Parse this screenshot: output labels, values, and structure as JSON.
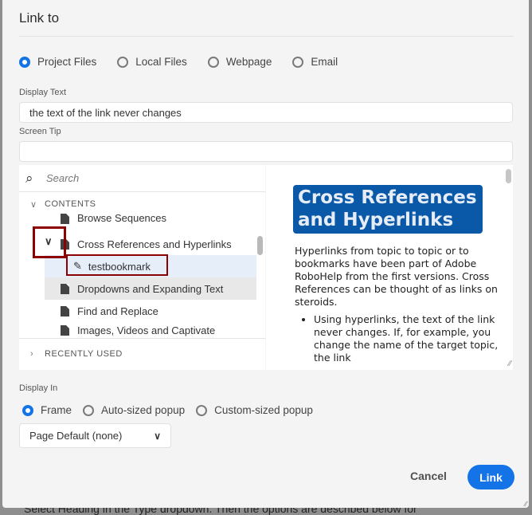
{
  "backdrop": {
    "text": "Select Heading in the Type dropdown. Then the options are described below for"
  },
  "dialog": {
    "title": "Link to",
    "link_types": [
      {
        "label": "Project Files",
        "selected": true
      },
      {
        "label": "Local Files",
        "selected": false
      },
      {
        "label": "Webpage",
        "selected": false
      },
      {
        "label": "Email",
        "selected": false
      }
    ],
    "display_text": {
      "label": "Display Text",
      "value": "the text of the link never changes"
    },
    "screen_tip": {
      "label": "Screen Tip",
      "value": ""
    },
    "tree": {
      "search_placeholder": "Search",
      "contents_label": "CONTENTS",
      "recently_used_label": "RECENTLY USED",
      "items": [
        {
          "label": "Browse Sequences",
          "type": "topic"
        },
        {
          "label": "Cross References and Hyperlinks",
          "type": "topic",
          "expanded": true
        },
        {
          "label": "testbookmark",
          "type": "bookmark",
          "selected": true
        },
        {
          "label": "Dropdowns and Expanding Text",
          "type": "topic",
          "hovered": true
        },
        {
          "label": "Find and Replace",
          "type": "topic"
        },
        {
          "label": "Images, Videos and Captivate",
          "type": "topic"
        }
      ]
    },
    "preview": {
      "heading": "Cross References and Hyperlinks",
      "paragraph": "Hyperlinks from topic to topic or to bookmarks have been part of Adobe RoboHelp from the first versions. Cross References can be thought of as links on steroids.",
      "bullet": "Using hyperlinks, the text of the link never changes. If, for example, you change the name of the target topic, the link"
    },
    "display_in": {
      "label": "Display In",
      "options": [
        {
          "label": "Frame",
          "selected": true
        },
        {
          "label": "Auto-sized popup",
          "selected": false
        },
        {
          "label": "Custom-sized popup",
          "selected": false
        }
      ],
      "frame_select": "Page Default (none)"
    },
    "cancel_label": "Cancel",
    "link_label": "Link"
  }
}
